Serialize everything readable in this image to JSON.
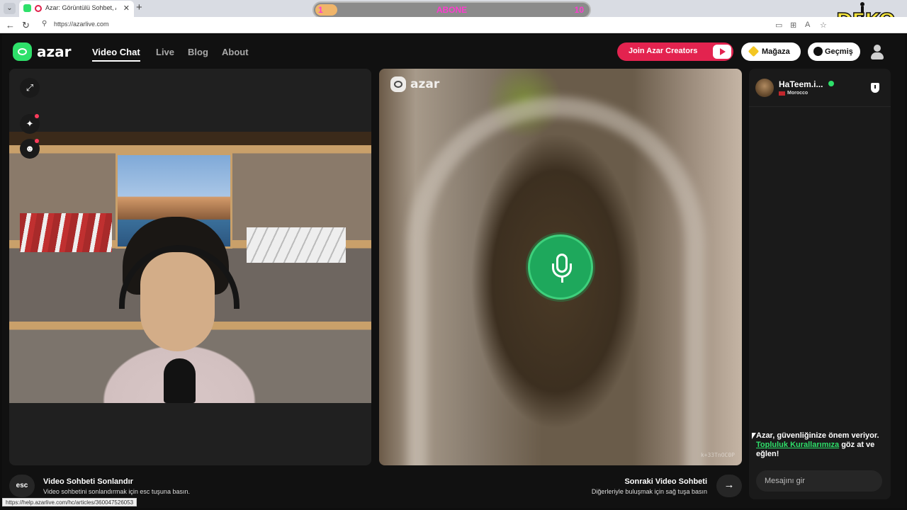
{
  "browser": {
    "tab_title": "Azar: Görüntülü Sohbet, Ar...",
    "url": "https://azarlive.com",
    "status_url": "https://help.azarlive.com/hc/articles/360047526053"
  },
  "overlay": {
    "subscribe_current": "1",
    "subscribe_label": "ABONE",
    "subscribe_goal": "10",
    "subscribe_progress": 0.1,
    "channel_logo": "DEKO"
  },
  "header": {
    "logo_text": "azar",
    "nav": [
      {
        "label": "Video Chat",
        "active": true
      },
      {
        "label": "Live",
        "active": false
      },
      {
        "label": "Blog",
        "active": false
      },
      {
        "label": "About",
        "active": false
      }
    ],
    "creators_label": "Join Azar Creators",
    "shop_label": "Mağaza",
    "history_label": "Geçmiş"
  },
  "left_panel": {
    "buttons": [
      "expand-icon",
      "sparkle-effects-icon",
      "sticker-icon"
    ]
  },
  "mid_panel": {
    "watermark": "azar",
    "user_code": "k+33TnOC0P",
    "mic_icon": "microphone-icon",
    "accent": "#1ea85c"
  },
  "chat": {
    "peer_name": "HaTeem.i...",
    "peer_country": "Morocco",
    "safety_text_1": "Azar, güvenliğinize önem veriyor.",
    "safety_link": "Topluluk Kurallarımıza",
    "safety_text_2": " göz at ve eğlen!",
    "input_placeholder": "Mesajını gir"
  },
  "footer": {
    "esc_key": "esc",
    "end_title": "Video Sohbeti Sonlandır",
    "end_sub": "Video sohbetini sonlandırmak için esc tuşuna basın.",
    "next_title": "Sonraki Video Sohbeti",
    "next_sub": "Diğerleriyle buluşmak için sağ tuşa basın",
    "next_key": "→"
  },
  "colors": {
    "brand_green": "#2ee06a",
    "creators_red": "#e3234f",
    "background": "#111111"
  }
}
